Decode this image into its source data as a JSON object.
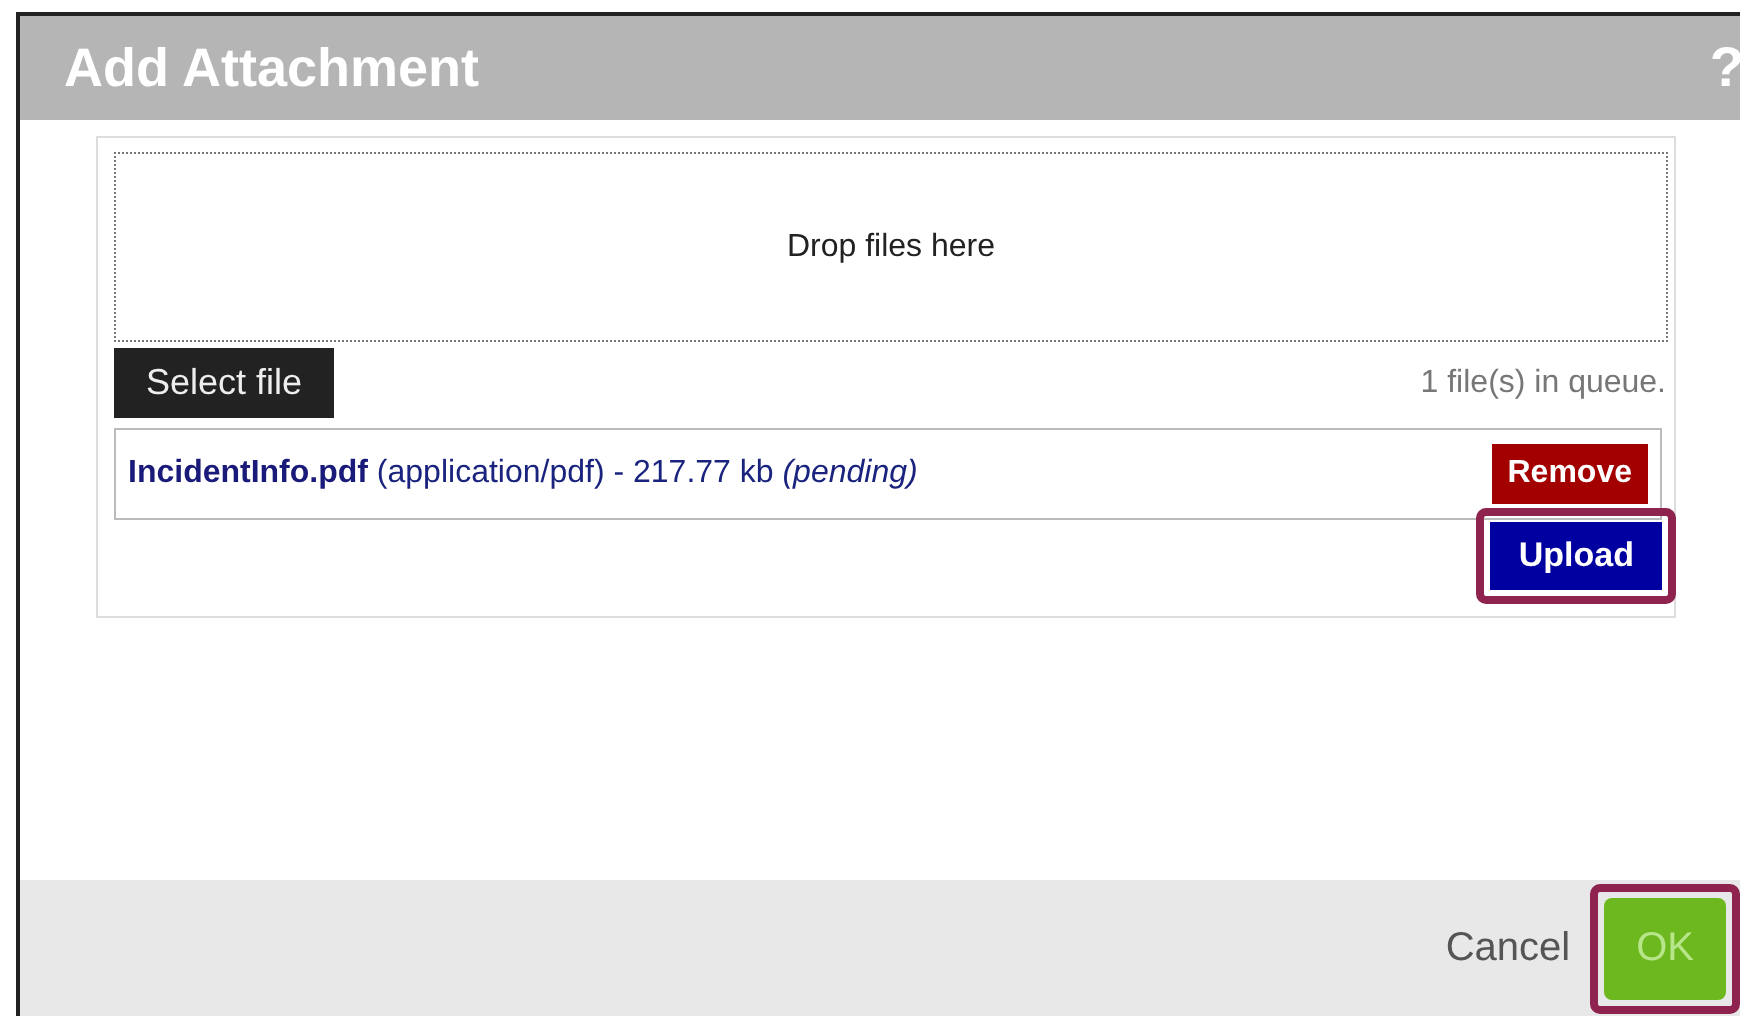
{
  "window": {
    "title": "Add Attachment",
    "help": "?"
  },
  "dropzone": {
    "label": "Drop files here"
  },
  "select_button": "Select file",
  "queue_status": "1 file(s) in queue.",
  "files": [
    {
      "description": "**IncidentInfo.pdf** (application/pdf) - 217.77 kb *(pending)*",
      "remove": "Remove"
    }
  ],
  "upload_button": {
    "label": "Upload",
    "highlighted": true
  },
  "footer": {
    "cancel": "Cancel",
    "ok": {
      "label": "OK",
      "highlighted": true
    }
  }
}
